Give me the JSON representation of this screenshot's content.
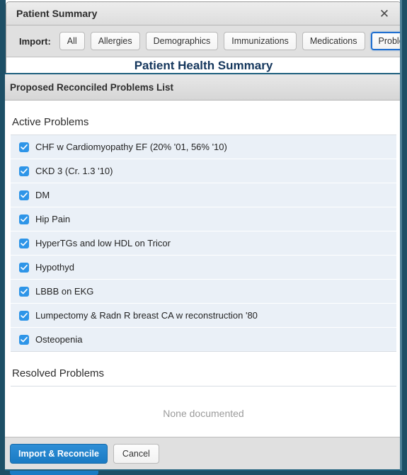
{
  "window": {
    "title": "Patient Summary",
    "close_icon": "close-icon"
  },
  "toolbar": {
    "label": "Import:",
    "buttons": [
      {
        "label": "All",
        "focused": false
      },
      {
        "label": "Allergies",
        "focused": false
      },
      {
        "label": "Demographics",
        "focused": false
      },
      {
        "label": "Immunizations",
        "focused": false
      },
      {
        "label": "Medications",
        "focused": false
      },
      {
        "label": "Problems",
        "focused": true
      }
    ]
  },
  "background_page": {
    "heading": "Patient Health Summary",
    "left_letter": "P"
  },
  "panel": {
    "header": "Proposed Reconciled Problems List",
    "active_section_title": "Active Problems",
    "active_problems": [
      {
        "label": "CHF w Cardiomyopathy EF (20% '01, 56% '10)",
        "checked": true
      },
      {
        "label": "CKD 3 (Cr. 1.3 '10)",
        "checked": true
      },
      {
        "label": "DM",
        "checked": true
      },
      {
        "label": "Hip Pain",
        "checked": true
      },
      {
        "label": "HyperTGs and low HDL on Tricor",
        "checked": true
      },
      {
        "label": "Hypothyd",
        "checked": true
      },
      {
        "label": "LBBB on EKG",
        "checked": true
      },
      {
        "label": "Lumpectomy & Radn R breast CA w reconstruction '80",
        "checked": true
      },
      {
        "label": "Osteopenia",
        "checked": true
      }
    ],
    "resolved_section_title": "Resolved Problems",
    "resolved_empty_text": "None documented"
  },
  "footer": {
    "primary_label": "Import & Reconcile",
    "secondary_label": "Cancel"
  },
  "colors": {
    "accent_blue": "#1a7bc4",
    "checkbox_blue": "#2e95e8",
    "panel_border": "#1d5f7d",
    "row_bg": "#eaf0f7",
    "heading_navy": "#14365c",
    "window_chrome": "#1d4f66"
  }
}
